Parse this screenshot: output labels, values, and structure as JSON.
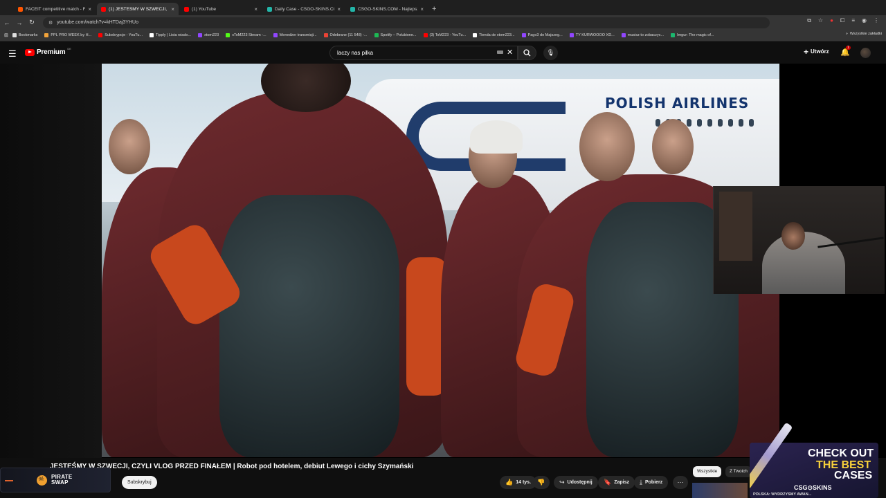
{
  "browser": {
    "tabs": [
      {
        "title": "FACEIT competitive match - FA",
        "color": "#ff5500",
        "active": false
      },
      {
        "title": "(1) JESTEŚMY W SZWECJI, C",
        "color": "#ff0000",
        "active": true
      },
      {
        "title": "(1) YouTube",
        "color": "#ff0000",
        "active": false
      },
      {
        "title": "Daily Case - CSGO-SKINS.COM",
        "color": "#23b5a8",
        "active": false
      },
      {
        "title": "CSGO-SKINS.COM - Najlepsze",
        "color": "#23b5a8",
        "active": false
      }
    ],
    "new_tab": "+",
    "url": "youtube.com/watch?v=kHTDaj3YHUo",
    "bookmarks": [
      {
        "label": "Bookmarks",
        "color": "#dddddd"
      },
      {
        "label": "PPL PRO WEEK by H...",
        "color": "#f2a33a"
      },
      {
        "label": "Subskrypcje - YouTu...",
        "color": "#ff0000"
      },
      {
        "label": "Tipply | Lista wiado...",
        "color": "#ffffff"
      },
      {
        "label": "xtom223",
        "color": "#9146ff"
      },
      {
        "label": "xToM223 Stream -...",
        "color": "#53fc18"
      },
      {
        "label": "Menedżer transmisji...",
        "color": "#9146ff"
      },
      {
        "label": "Odebrane (11 548) -...",
        "color": "#ea4335"
      },
      {
        "label": "Spotify – Polubione...",
        "color": "#1db954"
      },
      {
        "label": "(3) ToM223 - YouTu...",
        "color": "#ff0000"
      },
      {
        "label": "Tienda de xtom223...",
        "color": "#ffffff"
      },
      {
        "label": "Pago3 do Majszeg...",
        "color": "#9146ff"
      },
      {
        "label": "TY KURWOOOO XD...",
        "color": "#9146ff"
      },
      {
        "label": "musisz to zobaczyc...",
        "color": "#9146ff"
      },
      {
        "label": "Imgur: The magic of...",
        "color": "#1bb76e"
      }
    ],
    "bookmarks_other": "Wszystkie zakładki"
  },
  "youtube": {
    "logo_text": "Premium",
    "logo_country": "DE",
    "search_value": "laczy nas pilka",
    "create_label": "Utwórz",
    "notif_count": "1"
  },
  "video": {
    "airline_text": "POLISH AIRLINES",
    "title": "JESTEŚMY W SZWECJI, CZYLI VLOG PRZED FINAŁEM | Robot pod hotelem, debiut Lewego i cichy Szymański",
    "subscribe_label": "Subskrybuj",
    "likes": "14 tys.",
    "share_label": "Udostępnij",
    "save_label": "Zapisz",
    "download_label": "Pobierz",
    "more": "⋯"
  },
  "sponsor": {
    "line1": "PIRATE",
    "line2": "SWAP"
  },
  "sidebar_chips": [
    "Wszystkie",
    "Z Twoich"
  ],
  "ad": {
    "line1": "CHECK OUT",
    "line2": "THE BEST",
    "line3": "CASES",
    "brand": "CSG⊙SKINS"
  },
  "next_video_title": "POLSKA: WYDRZYSMY AWAN..."
}
